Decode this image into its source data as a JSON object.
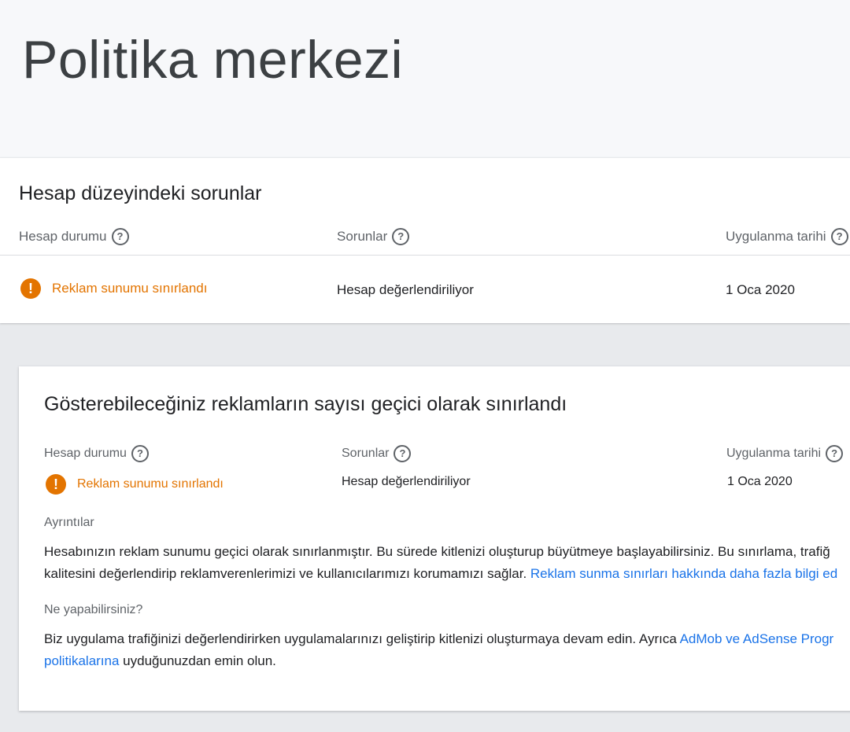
{
  "page": {
    "title": "Politika merkezi"
  },
  "account_issues": {
    "title": "Hesap düzeyindeki sorunlar",
    "columns": {
      "status": "Hesap durumu",
      "issues": "Sorunlar",
      "date": "Uygulanma tarihi"
    },
    "row": {
      "status": "Reklam sunumu sınırlandı",
      "issue": "Hesap değerlendiriliyor",
      "date": "1 Oca 2020"
    }
  },
  "detail": {
    "title": "Gösterebileceğiniz reklamların sayısı geçici olarak sınırlandı",
    "columns": {
      "status": "Hesap durumu",
      "issues": "Sorunlar",
      "date": "Uygulanma tarihi"
    },
    "row": {
      "status": "Reklam sunumu sınırlandı",
      "issue": "Hesap değerlendiriliyor",
      "date": "1 Oca 2020"
    },
    "details_label": "Ayrıntılar",
    "details_line1": "Hesabınızın reklam sunumu geçici olarak sınırlanmıştır. Bu sürede kitlenizi oluşturup büyütmeye başlayabilirsiniz. Bu sınırlama, trafiğ",
    "details_line2": "kalitesini değerlendirip reklamverenlerimizi ve kullanıcılarımızı korumamızı sağlar. ",
    "details_link": "Reklam sunma sınırları hakkında daha fazla bilgi ed",
    "what_label": "Ne yapabilirsiniz?",
    "what_line1": "Biz uygulama trafiğinizi değerlendirirken uygulamalarınızı geliştirip kitlenizi oluşturmaya devam edin. Ayrıca ",
    "what_link1": "AdMob ve AdSense Progr",
    "what_link2": "politikalarına",
    "what_line2": " uyduğunuzdan emin olun."
  },
  "icons": {
    "help": "help-circle-icon",
    "warning": "warning-circle-icon"
  },
  "colors": {
    "warning": "#e37400",
    "link": "#1a73e8",
    "header_bg": "#f7f8fa",
    "page_bg": "#e8eaed"
  }
}
